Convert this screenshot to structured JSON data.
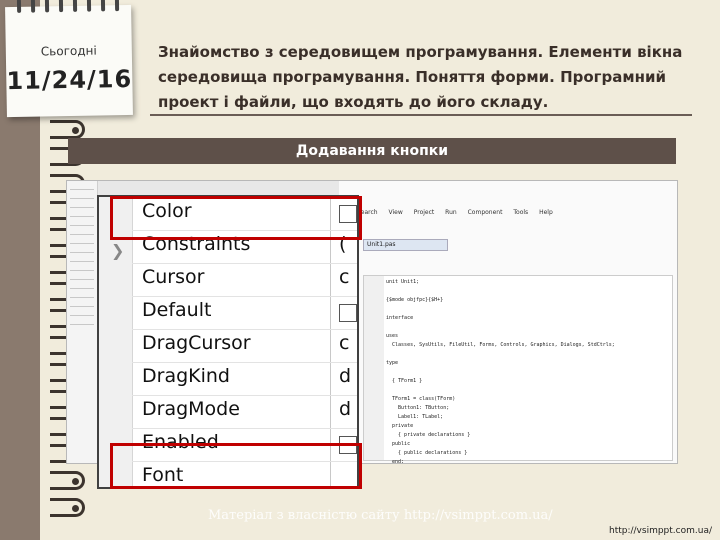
{
  "note": {
    "label": "Сьогодні",
    "date": "11/24/16"
  },
  "title": "Знайомство з середовищем програмування. Елементи вікна середовища програмування. Поняття форми. Програмний проект і файли, що входять до його складу.",
  "section_header": "Додавання кнопки",
  "ide": {
    "menu_items": [
      "Search",
      "View",
      "Project",
      "Run",
      "Component",
      "Tools",
      "Help"
    ],
    "code_tab": "Unit1.pas",
    "code_lines": [
      "unit Unit1;",
      "",
      "{$mode objfpc}{$H+}",
      "",
      "interface",
      "",
      "uses",
      "  Classes, SysUtils, FileUtil, Forms, Controls, Graphics, Dialogs, StdCtrls;",
      "",
      "type",
      "",
      "  { TForm1 }",
      "",
      "  TForm1 = class(TForm)",
      "    Button1: TButton;",
      "    Label1: TLabel;",
      "  private",
      "    { private declarations }",
      "  public",
      "    { public declarations }",
      "  end;"
    ]
  },
  "properties": [
    {
      "name": "Color",
      "value": ""
    },
    {
      "name": "Constraints",
      "value": "("
    },
    {
      "name": "Cursor",
      "value": "c"
    },
    {
      "name": "Default",
      "value": ""
    },
    {
      "name": "DragCursor",
      "value": "c"
    },
    {
      "name": "DragKind",
      "value": "d"
    },
    {
      "name": "DragMode",
      "value": "d"
    },
    {
      "name": "Enabled",
      "value": ""
    },
    {
      "name": "Font",
      "value": ""
    }
  ],
  "watermark": "Матеріал з власністю сайту http://vsimppt.com.ua/",
  "footer_link": "http://vsimppt.com.ua/",
  "colors": {
    "accent_bar": "#5e5049",
    "highlight": "#c00000",
    "page": "#f1ecdc"
  }
}
